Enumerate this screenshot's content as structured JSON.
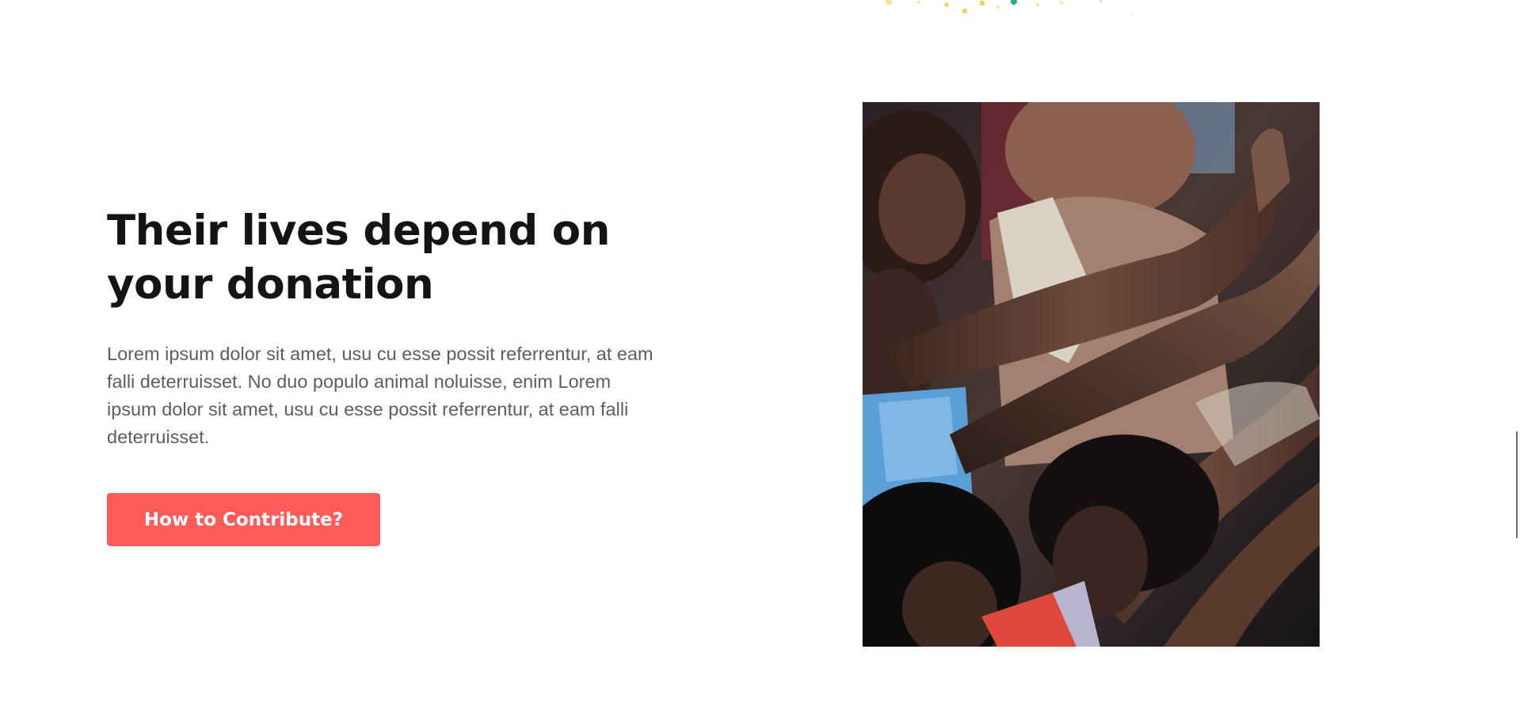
{
  "section": {
    "heading": "Their lives depend on your donation",
    "body": "Lorem ipsum dolor sit amet, usu cu esse possit referrentur, at eam falli deterruisset. No duo populo animal noluisse, enim Lorem ipsum dolor sit amet, usu cu esse possit referrentur, at eam falli deterruisset.",
    "button_label": "How to Contribute?"
  },
  "image": {
    "subject": "crowd-of-children-reaching-hands-photo"
  },
  "colors": {
    "accent": "#fe5a5a",
    "heading": "#141414",
    "body": "#5d5d5d"
  }
}
